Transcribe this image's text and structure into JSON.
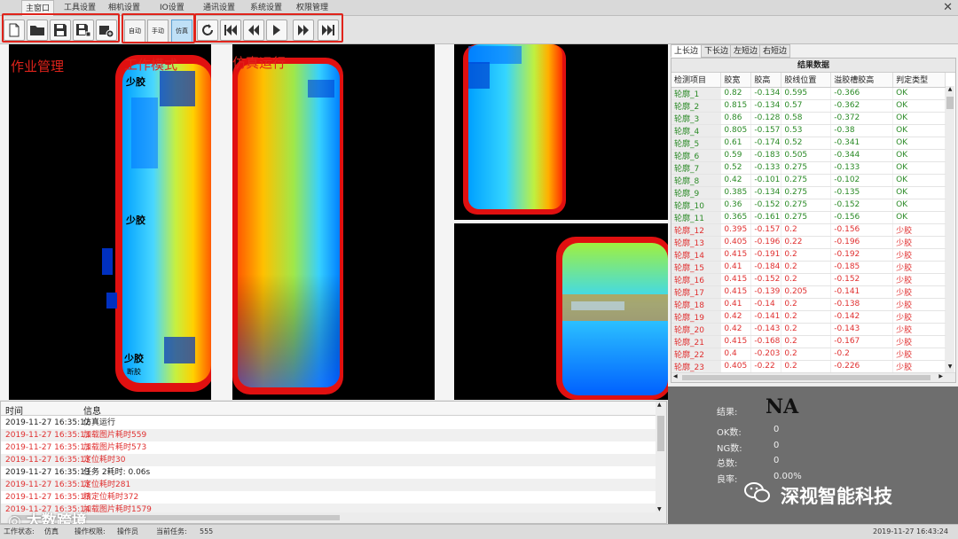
{
  "menu": [
    "主窗口",
    "工具设置",
    "相机设置",
    "IO设置",
    "通讯设置",
    "系统设置",
    "权限管理"
  ],
  "toolbar": {
    "mode_auto": "自动",
    "mode_manual": "手动",
    "mode_sim": "仿真",
    "active_mode": "仿真"
  },
  "annotations": {
    "job_mgmt": "作业管理",
    "work_mode": "工作模式",
    "sim_run": "仿真运行"
  },
  "image_labels": {
    "top": "少胶",
    "mid": "少胶",
    "bottom": "少胶",
    "bottom2": "断胶"
  },
  "right_tabs": [
    "上长边",
    "下长边",
    "左短边",
    "右短边"
  ],
  "table": {
    "title": "结果数据",
    "headers": [
      "检测项目",
      "胶宽",
      "胶高",
      "胶线位置",
      "溢胶槽胶高",
      "判定类型"
    ],
    "rows": [
      [
        "轮廓_1",
        "0.82",
        "-0.134",
        "0.595",
        "-0.366",
        "OK"
      ],
      [
        "轮廓_2",
        "0.815",
        "-0.134",
        "0.57",
        "-0.362",
        "OK"
      ],
      [
        "轮廓_3",
        "0.86",
        "-0.128",
        "0.58",
        "-0.372",
        "OK"
      ],
      [
        "轮廓_4",
        "0.805",
        "-0.157",
        "0.53",
        "-0.38",
        "OK"
      ],
      [
        "轮廓_5",
        "0.61",
        "-0.174",
        "0.52",
        "-0.341",
        "OK"
      ],
      [
        "轮廓_6",
        "0.59",
        "-0.183",
        "0.505",
        "-0.344",
        "OK"
      ],
      [
        "轮廓_7",
        "0.52",
        "-0.133",
        "0.275",
        "-0.133",
        "OK"
      ],
      [
        "轮廓_8",
        "0.42",
        "-0.101",
        "0.275",
        "-0.102",
        "OK"
      ],
      [
        "轮廓_9",
        "0.385",
        "-0.134",
        "0.275",
        "-0.135",
        "OK"
      ],
      [
        "轮廓_10",
        "0.36",
        "-0.152",
        "0.275",
        "-0.152",
        "OK"
      ],
      [
        "轮廓_11",
        "0.365",
        "-0.161",
        "0.275",
        "-0.156",
        "OK"
      ],
      [
        "轮廓_12",
        "0.395",
        "-0.157",
        "0.2",
        "-0.156",
        "少胶"
      ],
      [
        "轮廓_13",
        "0.405",
        "-0.196",
        "0.22",
        "-0.196",
        "少胶"
      ],
      [
        "轮廓_14",
        "0.415",
        "-0.191",
        "0.2",
        "-0.192",
        "少胶"
      ],
      [
        "轮廓_15",
        "0.41",
        "-0.184",
        "0.2",
        "-0.185",
        "少胶"
      ],
      [
        "轮廓_16",
        "0.415",
        "-0.152",
        "0.2",
        "-0.152",
        "少胶"
      ],
      [
        "轮廓_17",
        "0.415",
        "-0.139",
        "0.205",
        "-0.141",
        "少胶"
      ],
      [
        "轮廓_18",
        "0.41",
        "-0.14",
        "0.2",
        "-0.138",
        "少胶"
      ],
      [
        "轮廓_19",
        "0.42",
        "-0.141",
        "0.2",
        "-0.142",
        "少胶"
      ],
      [
        "轮廓_20",
        "0.42",
        "-0.143",
        "0.2",
        "-0.143",
        "少胶"
      ],
      [
        "轮廓_21",
        "0.415",
        "-0.168",
        "0.2",
        "-0.167",
        "少胶"
      ],
      [
        "轮廓_22",
        "0.4",
        "-0.203",
        "0.2",
        "-0.2",
        "少胶"
      ],
      [
        "轮廓_23",
        "0.405",
        "-0.22",
        "0.2",
        "-0.226",
        "少胶"
      ]
    ]
  },
  "result": {
    "label": "结果:",
    "value": "NA",
    "ok_label": "OK数:",
    "ok": "0",
    "ng_label": "NG数:",
    "ng": "0",
    "total_label": "总数:",
    "total": "0",
    "rate_label": "良率:",
    "rate": "0.00%"
  },
  "watermark": "深视智能科技",
  "log": {
    "col_time": "时间",
    "col_info": "信息",
    "rows": [
      {
        "time": "2019-11-27 16:35:12",
        "info": "仿真运行",
        "level": "normal"
      },
      {
        "time": "2019-11-27 16:35:13",
        "info": "加载图片耗时559",
        "level": "error"
      },
      {
        "time": "2019-11-27 16:35:13",
        "info": "加载图片耗时573",
        "level": "error"
      },
      {
        "time": "2019-11-27 16:35:13",
        "info": "定位耗时30",
        "level": "error"
      },
      {
        "time": "2019-11-27 16:35:13",
        "info": "任务 2耗时: 0.06s",
        "level": "normal"
      },
      {
        "time": "2019-11-27 16:35:13",
        "info": "定位耗时281",
        "level": "error"
      },
      {
        "time": "2019-11-27 16:35:13",
        "info": "精定位耗时372",
        "level": "error"
      },
      {
        "time": "2019-11-27 16:35:14",
        "info": "加载图片耗时1579",
        "level": "error"
      }
    ]
  },
  "log_watermark": "大数跨境",
  "status": {
    "state_label": "工作状态:",
    "state": "仿真",
    "perm_label": "操作权限:",
    "perm": "操作员",
    "task_label": "当前任务:",
    "task": "555",
    "datetime": "2019-11-27 16:43:24"
  },
  "colors": {
    "ok": "#2a8a26",
    "ng": "#e03030",
    "annotation": "#e0231b"
  }
}
